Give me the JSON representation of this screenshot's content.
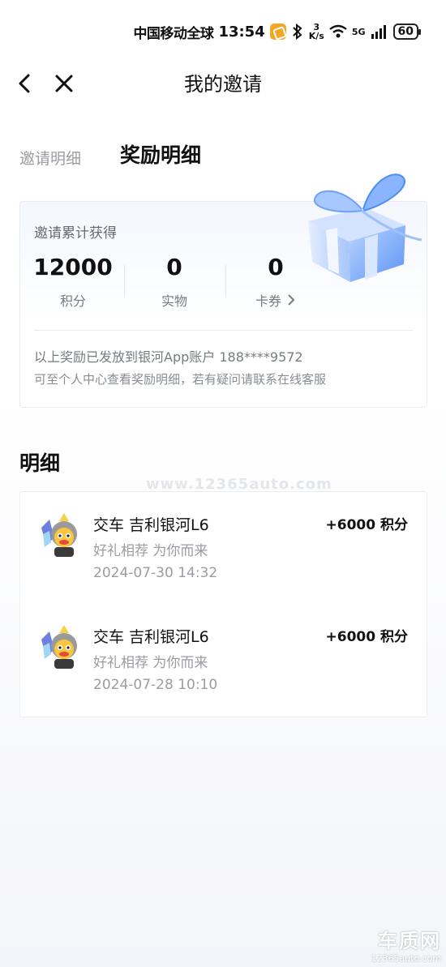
{
  "status_bar": {
    "carrier": "中国移动全球",
    "time": "13:54",
    "speed_top": "3",
    "speed_unit": "K/s",
    "network": "5G",
    "battery": "60"
  },
  "nav": {
    "title": "我的邀请"
  },
  "tabs": [
    {
      "label": "邀请明细",
      "active": false
    },
    {
      "label": "奖励明细",
      "active": true
    }
  ],
  "summary": {
    "label": "邀请累计获得",
    "stats": [
      {
        "value": "12000",
        "unit": "积分"
      },
      {
        "value": "0",
        "unit": "实物"
      },
      {
        "value": "0",
        "unit": "卡券"
      }
    ],
    "note1": "以上奖励已发放到银河App账户 188****9572",
    "note2": "可至个人中心查看奖励明细，若有疑问请联系在线客服"
  },
  "detail": {
    "title": "明细",
    "records": [
      {
        "title": "交车 吉利银河L6",
        "subtitle": "好礼相荐 为你而来",
        "time": "2024-07-30 14:32",
        "points": "+6000 积分"
      },
      {
        "title": "交车 吉利银河L6",
        "subtitle": "好礼相荐 为你而来",
        "time": "2024-07-28 10:10",
        "points": "+6000 积分"
      }
    ]
  },
  "watermark": "www.12365auto.com",
  "brand": {
    "name": "车质网",
    "url": "12365auto.com"
  },
  "colors": {
    "accent_blue": "#4d8ef5",
    "text_primary": "#111111",
    "text_secondary": "#9a9ca3"
  }
}
